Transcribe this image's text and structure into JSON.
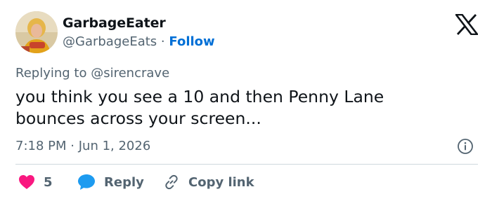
{
  "author": {
    "display_name": "GarbageEater",
    "handle": "@GarbageEats",
    "separator": "·",
    "follow_label": "Follow"
  },
  "reply_to": {
    "prefix": "Replying to",
    "mention": "@sirencrave"
  },
  "tweet": {
    "line1": "you think you see a 10 and then Penny Lane",
    "line2": "bounces across your screen..."
  },
  "meta": {
    "time": "7:18 PM",
    "separator": "·",
    "date": "Jun 1, 2026"
  },
  "actions": {
    "like_count": "5",
    "reply_label": "Reply",
    "copy_label": "Copy link"
  },
  "colors": {
    "accent": "#006fd6",
    "like": "#f91880",
    "reply_icon": "#1d9bf0",
    "muted": "#536471",
    "text": "#0f1419",
    "divider": "#cfd9de"
  },
  "icons": [
    "x-logo-icon",
    "info-icon",
    "heart-icon",
    "speech-bubble-icon",
    "link-icon"
  ]
}
